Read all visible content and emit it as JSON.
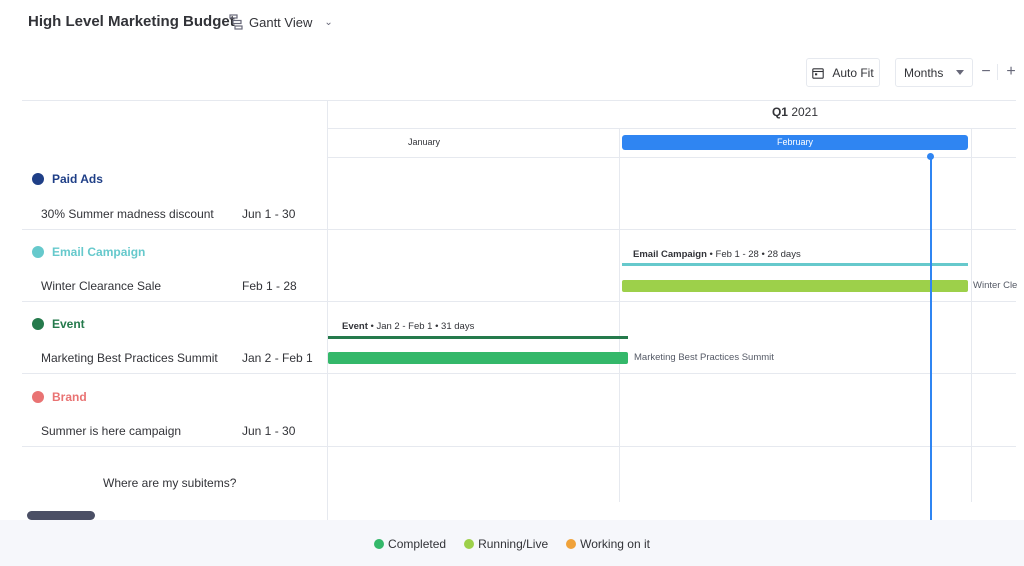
{
  "header": {
    "title": "High Level Marketing Budget",
    "view_icon": "gantt-icon",
    "view_label": "Gantt View"
  },
  "toolbar": {
    "autofit_label": "Auto Fit",
    "autofit_icon": "calendar-icon",
    "scale_value": "Months",
    "zoom_out_label": "−",
    "zoom_in_label": "+"
  },
  "timeline": {
    "quarter": "Q1",
    "year": "2021",
    "months": [
      "January",
      "February"
    ],
    "selected_month": "February"
  },
  "groups": [
    {
      "name": "Paid Ads",
      "color": "#1f3f87",
      "item": {
        "name": "30% Summer madness discount",
        "date": "Jun 1 - 30"
      }
    },
    {
      "name": "Email Campaign",
      "color": "#66c9cc",
      "item": {
        "name": "Winter Clearance Sale",
        "date": "Feb 1 - 28",
        "bar_label": "Winter Cle"
      },
      "summary": {
        "name": "Email Campaign",
        "detail": " • Feb 1 - 28 • 28 days"
      }
    },
    {
      "name": "Event",
      "color": "#257a4c",
      "item": {
        "name": "Marketing Best Practices Summit",
        "date": "Jan 2 - Feb 1",
        "bar_label": "Marketing Best Practices Summit"
      },
      "summary": {
        "name": "Event",
        "detail": " • Jan 2 - Feb 1 • 31 days"
      }
    },
    {
      "name": "Brand",
      "color": "#e97373",
      "item": {
        "name": "Summer is here campaign",
        "date": "Jun 1 - 30"
      }
    }
  ],
  "subitems_link": "Where are my subitems?",
  "legend": [
    {
      "label": "Completed",
      "color": "#34b86a"
    },
    {
      "label": "Running/Live",
      "color": "#9dd04a"
    },
    {
      "label": "Working on it",
      "color": "#f0a23a"
    }
  ],
  "status_colors": {
    "completed": "#34b86a",
    "running": "#9dd04a",
    "today_marker": "#2f85f2"
  }
}
